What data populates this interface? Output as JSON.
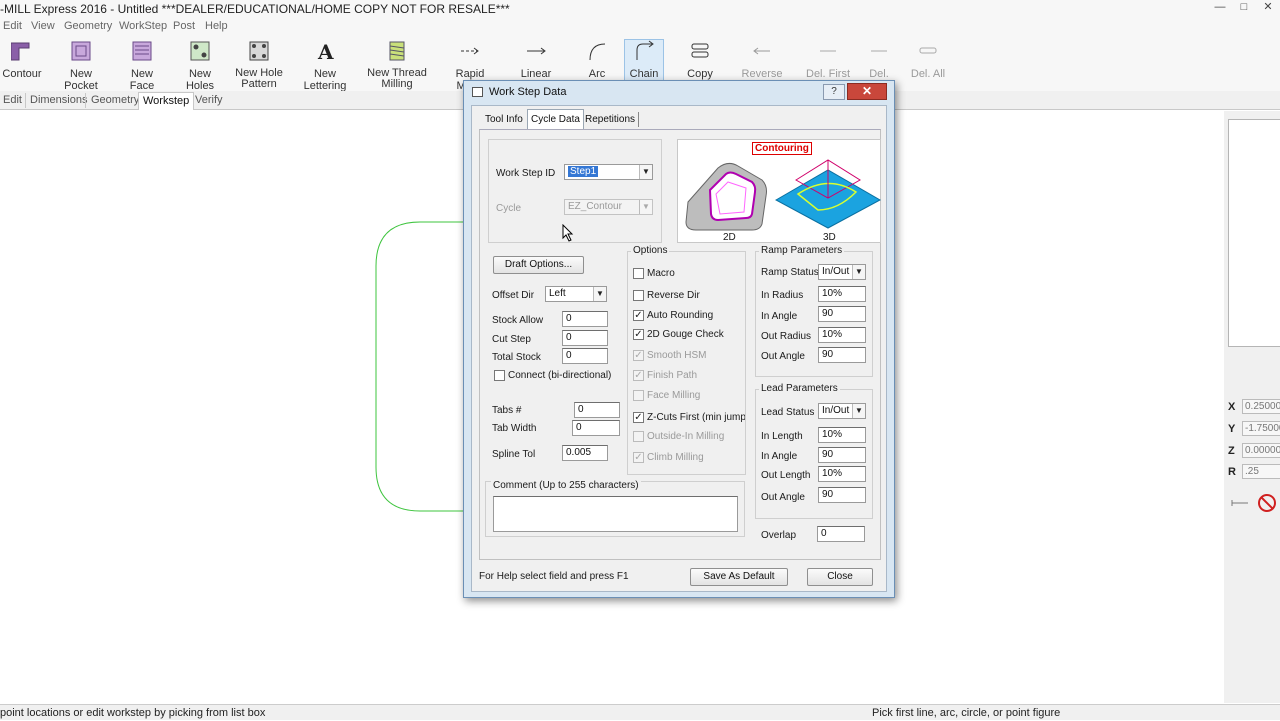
{
  "window": {
    "title": "-MILL Express 2016 - Untitled   ***DEALER/EDUCATIONAL/HOME COPY NOT FOR RESALE***"
  },
  "menu": [
    "Edit",
    "View",
    "Geometry",
    "WorkStep",
    "Post",
    "Help"
  ],
  "toolbar": {
    "contour": "Contour",
    "new_pocket": "New Pocket",
    "new_face": "New Face",
    "new_holes": "New Holes",
    "new_hole_pattern": [
      "New Hole",
      "Pattern"
    ],
    "new_lettering": "New Lettering",
    "new_thread_milling": [
      "New Thread",
      "Milling"
    ],
    "rapid_move": "Rapid Move",
    "linear_move": "Linear Move",
    "arc_move": "Arc Move",
    "chain": "Chain",
    "copy_path": "Copy Path",
    "reverse_dir": "Reverse Dir.",
    "del_first": "Del. First",
    "del_last": "Del. Last",
    "del_all": "Del. All"
  },
  "mode_tabs": [
    "Edit",
    "Dimensions",
    "Geometry",
    "Workstep",
    "Verify"
  ],
  "coords": {
    "x_label": "X",
    "x_value": "0.25000",
    "y_label": "Y",
    "y_value": "-1.75000",
    "z_label": "Z",
    "z_value": "0.00000",
    "r_label": "R",
    "r_value": ".25"
  },
  "status": {
    "left": "point locations or edit workstep by picking from list box",
    "right": "Pick first line, arc, circle, or point figure"
  },
  "dialog": {
    "title": "Work Step Data",
    "help_btn": "?",
    "close_btn": "✕",
    "tabs": [
      "Tool Info",
      "Cycle Data",
      "Repetitions"
    ],
    "work_step_id_label": "Work Step ID",
    "work_step_id_value": "Step1",
    "cycle_label": "Cycle",
    "cycle_value": "EZ_Contour",
    "preview_title": "Contouring",
    "preview_2d": "2D",
    "preview_3d": "3D",
    "draft_options": "Draft Options...",
    "offset_dir_label": "Offset Dir",
    "offset_dir_value": "Left",
    "stock_allow_label": "Stock Allow",
    "stock_allow_value": "0",
    "cut_step_label": "Cut Step",
    "cut_step_value": "0",
    "total_stock_label": "Total Stock",
    "total_stock_value": "0",
    "connect_label": "Connect (bi-directional)",
    "tabs_num_label": "Tabs #",
    "tabs_num_value": "0",
    "tab_width_label": "Tab Width",
    "tab_width_value": "0",
    "spline_tol_label": "Spline Tol",
    "spline_tol_value": "0.005",
    "comment_label": "Comment  (Up to 255 characters)",
    "comment_value": "",
    "options_title": "Options",
    "options": [
      {
        "label": "Macro",
        "checked": false,
        "enabled": true
      },
      {
        "label": "Reverse Dir",
        "checked": false,
        "enabled": true
      },
      {
        "label": "Auto Rounding",
        "checked": true,
        "enabled": true
      },
      {
        "label": "2D Gouge Check",
        "checked": true,
        "enabled": true
      },
      {
        "label": "Smooth HSM",
        "checked": true,
        "enabled": false
      },
      {
        "label": "Finish Path",
        "checked": true,
        "enabled": false
      },
      {
        "label": "Face Milling",
        "checked": false,
        "enabled": false
      },
      {
        "label": "Z-Cuts First (min jumps",
        "checked": true,
        "enabled": true
      },
      {
        "label": "Outside-In Milling",
        "checked": false,
        "enabled": false
      },
      {
        "label": "Climb Milling",
        "checked": true,
        "enabled": false
      }
    ],
    "ramp_title": "Ramp Parameters",
    "ramp_status_label": "Ramp Status",
    "ramp_status_value": "In/Out",
    "ramp_in_radius_label": "In Radius",
    "ramp_in_radius_value": "10%",
    "ramp_in_angle_label": "In Angle",
    "ramp_in_angle_value": "90",
    "ramp_out_radius_label": "Out Radius",
    "ramp_out_radius_value": "10%",
    "ramp_out_angle_label": "Out Angle",
    "ramp_out_angle_value": "90",
    "lead_title": "Lead Parameters",
    "lead_status_label": "Lead Status",
    "lead_status_value": "In/Out",
    "lead_in_length_label": "In Length",
    "lead_in_length_value": "10%",
    "lead_in_angle_label": "In Angle",
    "lead_in_angle_value": "90",
    "lead_out_length_label": "Out Length",
    "lead_out_length_value": "10%",
    "lead_out_angle_label": "Out Angle",
    "lead_out_angle_value": "90",
    "overlap_label": "Overlap",
    "overlap_value": "0",
    "help_text": "For Help select field and press F1",
    "save_default": "Save As Default",
    "close": "Close"
  }
}
